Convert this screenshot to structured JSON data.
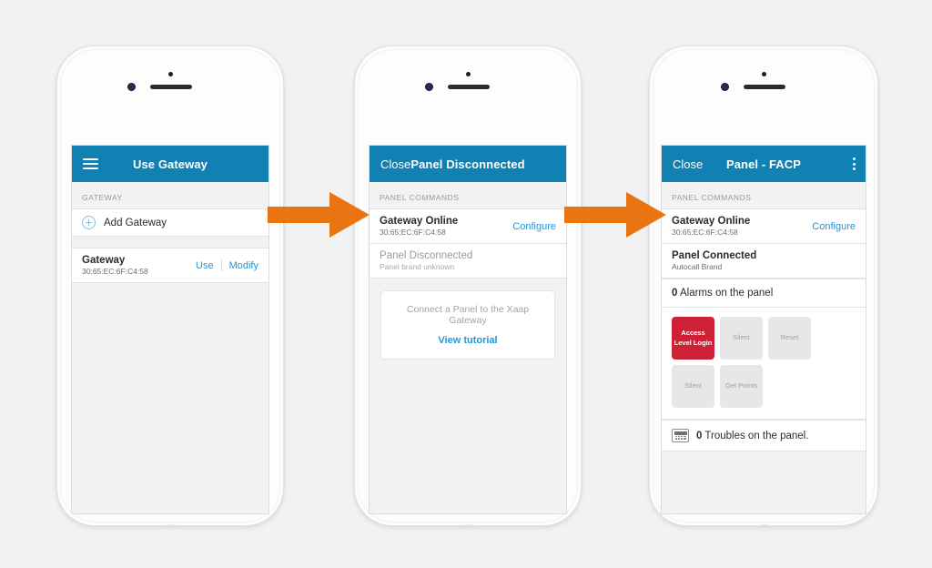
{
  "meta": {
    "accent_blue": "#1180b2",
    "link_blue": "#2196d8",
    "danger_red": "#cf2135",
    "arrow_orange": "#e87511",
    "background": "#f2f2f2"
  },
  "phone1": {
    "appbar": {
      "menu_icon": "hamburger-icon",
      "title": "Use Gateway"
    },
    "section_header": "GATEWAY",
    "add_gateway": {
      "icon": "circle-plus-icon",
      "label": "Add Gateway"
    },
    "gateway_row": {
      "title": "Gateway",
      "subtitle": "30:65:EC:6F:C4:58",
      "use_label": "Use",
      "modify_label": "Modify"
    }
  },
  "phone2": {
    "appbar": {
      "close_label": "Close",
      "title": "Panel Disconnected"
    },
    "section_header": "PANEL COMMANDS",
    "gateway_row": {
      "title": "Gateway Online",
      "subtitle": "30:65:EC:6F:C4:58",
      "action_label": "Configure"
    },
    "panel_row": {
      "title": "Panel Disconnected",
      "subtitle": "Panel brand unknown"
    },
    "tutorial_card": {
      "text": "Connect a Panel to the Xaap Gateway",
      "link_label": "View tutorial"
    }
  },
  "phone3": {
    "appbar": {
      "close_label": "Close",
      "title": "Panel - FACP",
      "overflow_icon": "kebab-menu-icon"
    },
    "section_header": "PANEL COMMANDS",
    "gateway_row": {
      "title": "Gateway Online",
      "subtitle": "30:65:EC:6F:C4:58",
      "action_label": "Configure"
    },
    "panel_row": {
      "title": "Panel Connected",
      "subtitle": "Autocall Brand"
    },
    "alarms": {
      "count": "0",
      "text": "Alarms on the panel"
    },
    "commands": [
      {
        "label": "Access Level Login",
        "style": "danger"
      },
      {
        "label": "Silent",
        "style": "normal"
      },
      {
        "label": "Reset",
        "style": "normal"
      },
      {
        "label": "Silent",
        "style": "normal"
      },
      {
        "label": "Get Points",
        "style": "normal"
      }
    ],
    "troubles": {
      "icon": "keypad-icon",
      "count": "0",
      "text": "Troubles on the panel."
    }
  },
  "arrows": [
    {
      "name": "flow-arrow-1"
    },
    {
      "name": "flow-arrow-2"
    }
  ]
}
